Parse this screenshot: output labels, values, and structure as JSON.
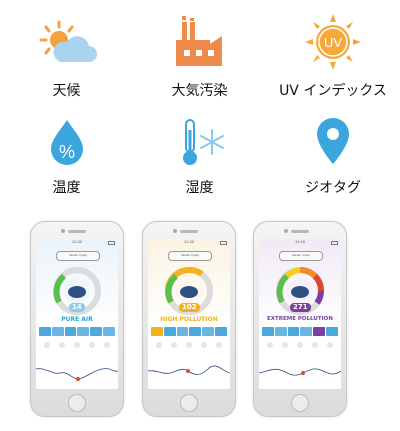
{
  "features": [
    {
      "label": "天候",
      "icon": "weather-icon"
    },
    {
      "label": "大気汚染",
      "icon": "factory-icon"
    },
    {
      "label": "UV インデックス",
      "icon": "uv-sun-icon",
      "icon_text": "UV"
    },
    {
      "label": "温度",
      "icon": "percent-drop-icon",
      "icon_text": "%"
    },
    {
      "label": "湿度",
      "icon": "thermometer-snowflake-icon"
    },
    {
      "label": "ジオタグ",
      "icon": "location-pin-icon"
    }
  ],
  "phones": [
    {
      "time": "12:00",
      "location": "Verein Quay",
      "value": "14",
      "status": "PURE AIR",
      "status_color": "#2aa7d8",
      "value_color": "#8fcbe8"
    },
    {
      "time": "12:00",
      "location": "Verein Quay",
      "value": "102",
      "status": "HIGH POLLUTION",
      "status_color": "#f2b320",
      "value_color": "#f2b320"
    },
    {
      "time": "12:00",
      "location": "Verein Quay",
      "value": "271",
      "status": "EXTREME POLLUTION",
      "status_color": "#7a3fa0",
      "value_color": "#7a3fa0"
    }
  ],
  "colors": {
    "accent_blue": "#2aa7d8",
    "accent_orange": "#f4a23a",
    "dark": "#111111"
  }
}
